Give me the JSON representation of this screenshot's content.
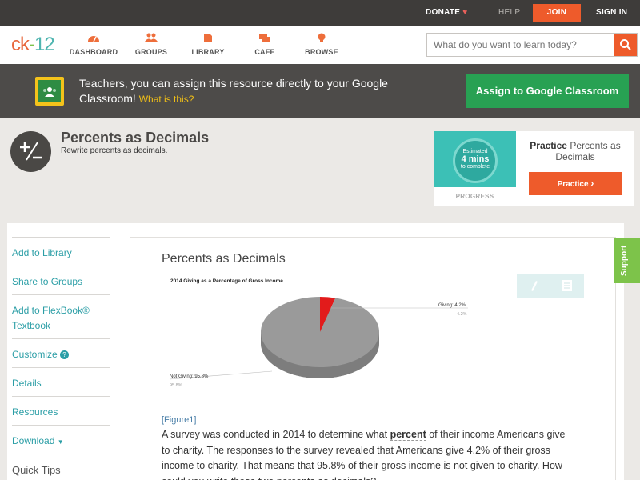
{
  "topbar": {
    "donate": "DONATE",
    "help": "HELP",
    "join": "JOIN",
    "signin": "SIGN IN"
  },
  "logo": {
    "c": "ck",
    "dash": "-",
    "n": "12"
  },
  "nav": {
    "dashboard": "DASHBOARD",
    "groups": "GROUPS",
    "library": "LIBRARY",
    "cafe": "CAFE",
    "browse": "BROWSE"
  },
  "search": {
    "placeholder": "What do you want to learn today?"
  },
  "banner": {
    "text": "Teachers, you can assign this resource directly to your Google Classroom!",
    "what": "What is this?",
    "assign": "Assign to Google Classroom"
  },
  "page": {
    "title": "Percents as Decimals",
    "subtitle": "Rewrite percents as decimals."
  },
  "practice": {
    "estimated": "Estimated",
    "mins": "4 mins",
    "complete": "to complete",
    "progress": "PROGRESS",
    "label_bold": "Practice",
    "label_rest": "Percents as Decimals",
    "button": "Practice"
  },
  "sidebar": {
    "add_library": "Add to Library",
    "share_groups": "Share to Groups",
    "add_flexbook": "Add to FlexBook® Textbook",
    "customize": "Customize",
    "details": "Details",
    "resources": "Resources",
    "download": "Download",
    "quick_tips": "Quick Tips"
  },
  "article": {
    "title": "Percents as Decimals",
    "figure_caption": "[Figure1]",
    "para_before": "A survey was conducted in 2014 to determine what ",
    "para_keyword": "percent",
    "para_after": " of their income Americans give to charity. The responses to the survey revealed that Americans give 4.2% of their gross income to charity. That means that 95.8% of their gross income is not given to charity. How could you write these two percents as decimals?"
  },
  "support": "Support",
  "colors": {
    "accent": "#ee5b2b",
    "link": "#2b9ea6",
    "google_green": "#28a153",
    "support_green": "#7dc34a"
  },
  "chart_data": {
    "type": "pie",
    "title": "2014 Giving as a Percentage of Gross Income",
    "categories": [
      "Giving",
      "Not Giving"
    ],
    "values": [
      4.2,
      95.8
    ],
    "labels": [
      "Giving: 4.2%",
      "Not Giving: 95.8%"
    ],
    "data_labels": [
      "4.2%",
      "95.8%"
    ],
    "colors": [
      "#e21b1b",
      "#9a9a9a"
    ]
  }
}
